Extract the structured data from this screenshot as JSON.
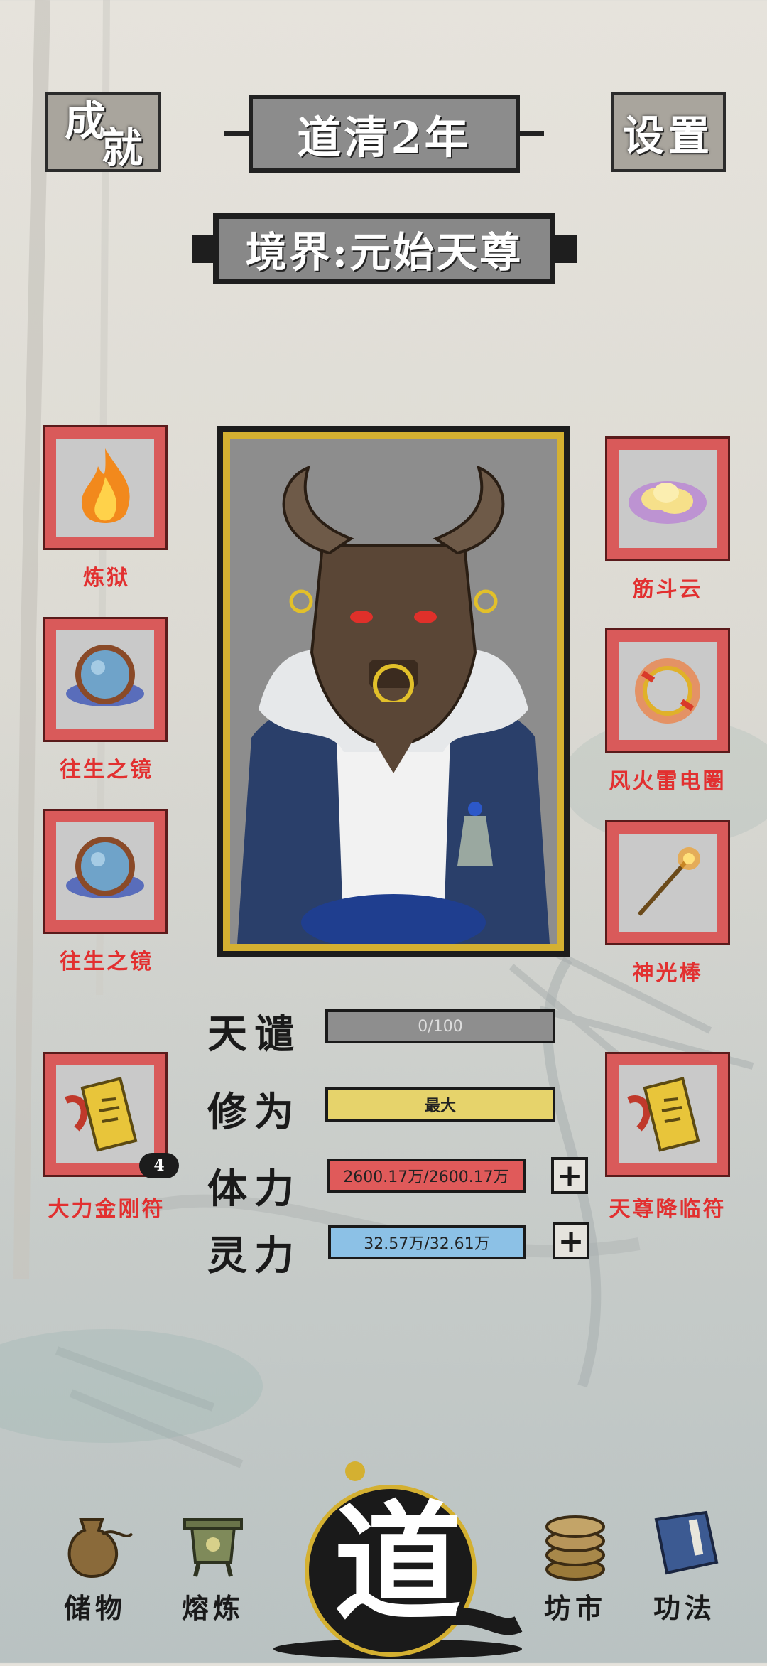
{
  "header": {
    "achievements_label_1": "成",
    "achievements_label_2": "就",
    "year": "道清2年",
    "settings_label": "设置",
    "realm": "境界:元始天尊"
  },
  "left_items": [
    {
      "name": "炼狱",
      "icon": "fire-icon"
    },
    {
      "name": "往生之镜",
      "icon": "mirror-icon"
    },
    {
      "name": "往生之镜",
      "icon": "mirror-icon"
    },
    {
      "name": "大力金刚符",
      "icon": "talisman-icon",
      "count": "4"
    }
  ],
  "right_items": [
    {
      "name": "筋斗云",
      "icon": "cloud-icon"
    },
    {
      "name": "风火雷电圈",
      "icon": "ring-icon"
    },
    {
      "name": "神光棒",
      "icon": "staff-icon"
    },
    {
      "name": "天尊降临符",
      "icon": "talisman-icon"
    }
  ],
  "stats": {
    "tianqian": {
      "label": "天谴",
      "value": "0/100",
      "color": "#8e8e8e",
      "fill": 0
    },
    "xiuwei": {
      "label": "修为",
      "value": "最大",
      "color": "#e6d36b",
      "fill": 1
    },
    "tili": {
      "label": "体力",
      "value": "2600.17万/2600.17万",
      "color": "#e05a5a",
      "fill": 1
    },
    "lingli": {
      "label": "灵力",
      "value": "32.57万/32.61万",
      "color": "#8cc1e6",
      "fill": 0.9988
    }
  },
  "nav": {
    "storage": "储物",
    "smelt": "熔炼",
    "center": "道",
    "market": "坊市",
    "skills": "功法"
  },
  "colors": {
    "slot_border": "#d95a5a",
    "label_red": "#e23030",
    "gold": "#d4b031"
  }
}
